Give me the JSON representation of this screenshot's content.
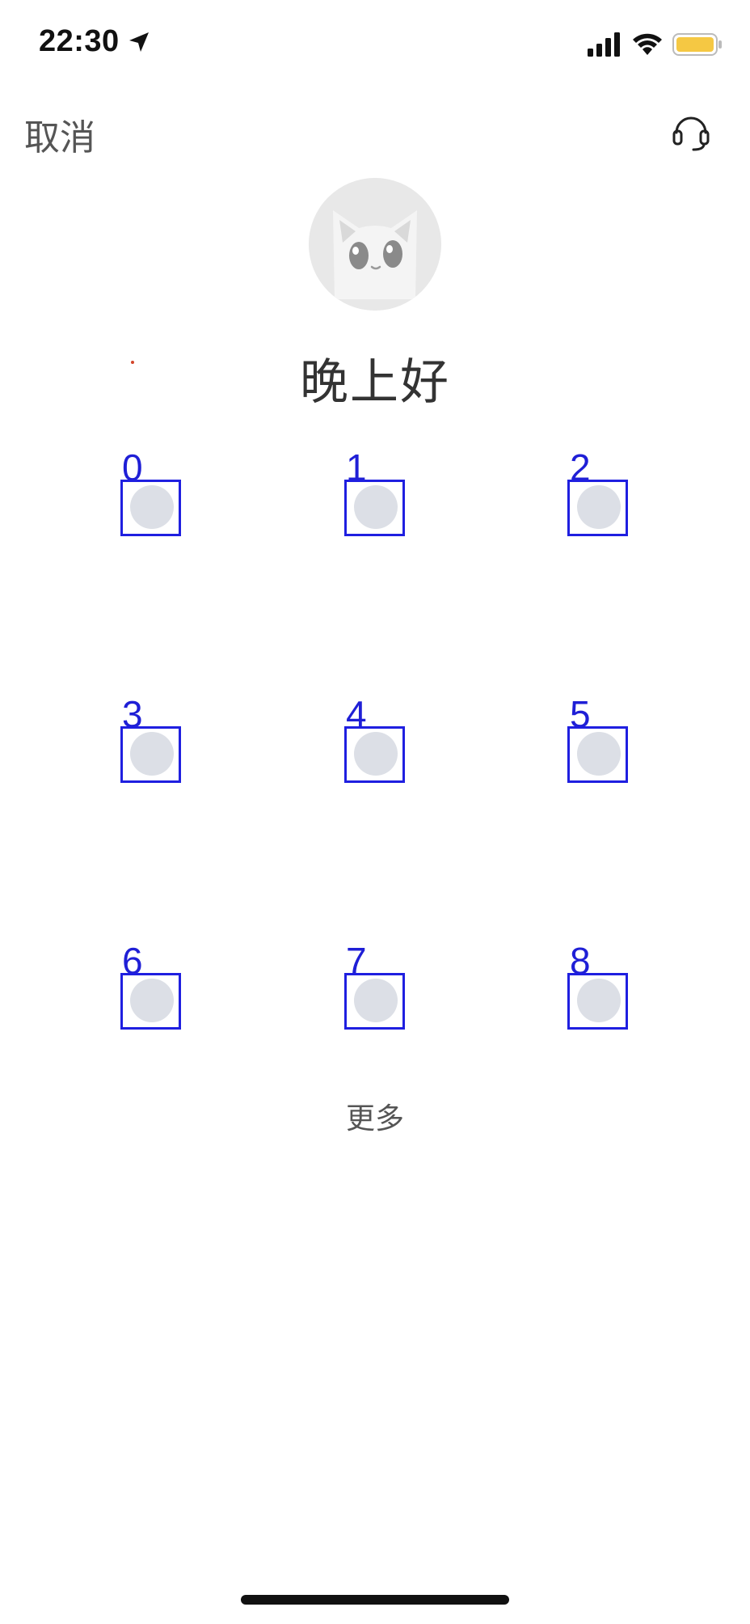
{
  "status_bar": {
    "time": "22:30",
    "icons": [
      "location-arrow-icon",
      "signal-icon",
      "wifi-icon",
      "battery-icon"
    ],
    "battery_color": "#f5c843"
  },
  "nav": {
    "cancel_label": "取消",
    "support_icon": "headset-icon"
  },
  "greeting": "晚上好",
  "accounts": [
    {
      "label": "0"
    },
    {
      "label": "1"
    },
    {
      "label": "2"
    },
    {
      "label": "3"
    },
    {
      "label": "4"
    },
    {
      "label": "5"
    },
    {
      "label": "6"
    },
    {
      "label": "7"
    },
    {
      "label": "8"
    }
  ],
  "more_label": "更多",
  "colors": {
    "annotation_blue": "#1f1fe0",
    "placeholder_gray": "#dcdfe6"
  }
}
